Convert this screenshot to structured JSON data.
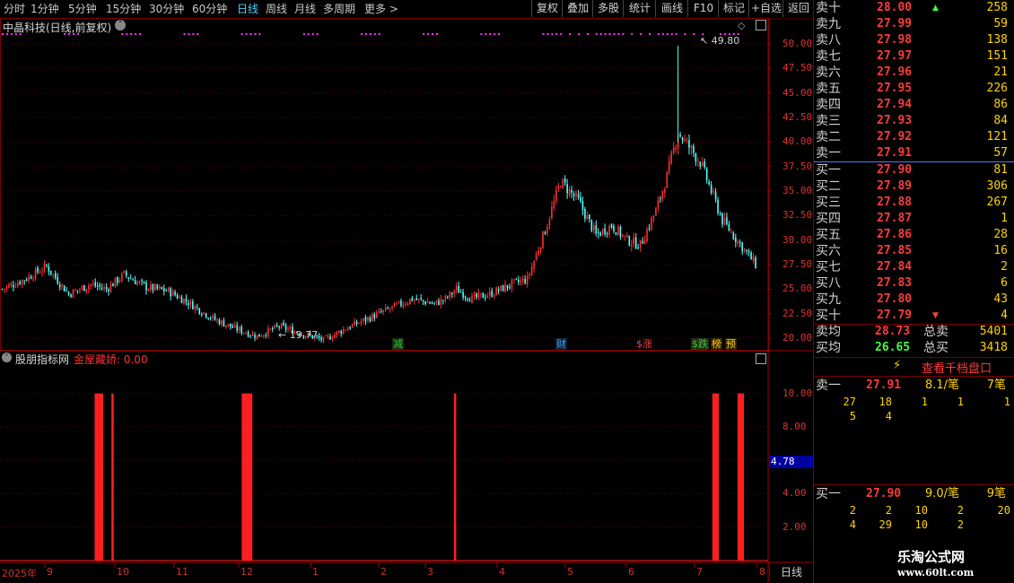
{
  "toolbar": {
    "periods": [
      "分时",
      "1分钟",
      "5分钟",
      "15分钟",
      "30分钟",
      "60分钟",
      "日线",
      "周线",
      "月线",
      "多周期",
      "更多 >"
    ],
    "active_period": "日线",
    "buttons": [
      "复权",
      "叠加",
      "多股",
      "统计",
      "画线",
      "F10",
      "标记",
      "+自选",
      "返回"
    ]
  },
  "chart": {
    "stock_title": "中晶科技(日线,前复权)",
    "price_axis": [
      "50.00",
      "47.50",
      "45.00",
      "42.50",
      "40.00",
      "37.50",
      "35.00",
      "32.50",
      "30.00",
      "27.50",
      "25.00",
      "22.50",
      "20.00"
    ],
    "high_label": "49.80",
    "low_label": "19.77",
    "events": [
      {
        "text": "减",
        "color": "#40c040"
      },
      {
        "text": "财",
        "color": "#40a0ff"
      },
      {
        "text": "$涨",
        "color": "#ff4040"
      },
      {
        "text": "$跌",
        "color": "#40c040"
      },
      {
        "text": "榜",
        "color": "#ffd400"
      },
      {
        "text": "预",
        "color": "#ffd400"
      }
    ],
    "indicator_title": "股朋指标网",
    "indicator_value_label": "金屋藏娇: 0.00",
    "indicator_axis": [
      "10.00",
      "8.00",
      "6.00",
      "4.00",
      "2.00"
    ],
    "indicator_cursor": "4.78",
    "date_axis": [
      "2025年",
      "9",
      "10",
      "11",
      "12",
      "1",
      "2",
      "3",
      "4",
      "5",
      "6",
      "7",
      "8"
    ],
    "period_label": "日线"
  },
  "chart_data": {
    "type": "line",
    "title": "中晶科技(日线,前复权)",
    "xlabel": "",
    "ylabel": "",
    "ylim": [
      19.0,
      51.0
    ],
    "x": [
      0,
      10,
      20,
      30,
      40,
      47,
      55,
      65,
      75,
      85,
      95,
      105,
      115,
      125,
      135,
      145,
      155,
      165,
      175,
      185,
      195,
      200,
      205,
      212,
      220,
      230,
      237,
      245,
      252,
      260,
      268,
      275,
      282,
      288,
      295,
      300,
      305,
      315,
      325,
      340
    ],
    "series": [
      {
        "name": "",
        "values": [
          25.0,
          26.0,
          27.3,
          24.5,
          25.5,
          25.0,
          26.5,
          25.2,
          24.8,
          23.5,
          22.0,
          21.0,
          20.2,
          21.2,
          20.5,
          19.8,
          21.0,
          22.0,
          23.0,
          24.0,
          23.5,
          24.0,
          25.0,
          24.0,
          24.5,
          25.5,
          26.0,
          31.0,
          36.0,
          34.0,
          30.5,
          31.5,
          30.0,
          29.5,
          33.0,
          36.5,
          41.0,
          38.0,
          32.0,
          27.5
        ]
      }
    ],
    "indicator_series": {
      "name": "金屋藏娇",
      "ylim": [
        0,
        11
      ],
      "spikes_x_index": [
        22,
        23,
        24,
        25,
        30,
        92,
        93,
        94,
        95,
        96,
        193,
        316,
        317,
        318,
        328,
        329,
        330
      ],
      "spike_value": 10.0
    }
  },
  "orderbook": {
    "asks": [
      {
        "label": "卖十",
        "price": "28.00",
        "vol": "258",
        "arrow": "up"
      },
      {
        "label": "卖九",
        "price": "27.99",
        "vol": "59"
      },
      {
        "label": "卖八",
        "price": "27.98",
        "vol": "138"
      },
      {
        "label": "卖七",
        "price": "27.97",
        "vol": "151"
      },
      {
        "label": "卖六",
        "price": "27.96",
        "vol": "21"
      },
      {
        "label": "卖五",
        "price": "27.95",
        "vol": "226"
      },
      {
        "label": "卖四",
        "price": "27.94",
        "vol": "86"
      },
      {
        "label": "卖三",
        "price": "27.93",
        "vol": "84"
      },
      {
        "label": "卖二",
        "price": "27.92",
        "vol": "121"
      },
      {
        "label": "卖一",
        "price": "27.91",
        "vol": "57"
      }
    ],
    "bids": [
      {
        "label": "买一",
        "price": "27.90",
        "vol": "81"
      },
      {
        "label": "买二",
        "price": "27.89",
        "vol": "306"
      },
      {
        "label": "买三",
        "price": "27.88",
        "vol": "267"
      },
      {
        "label": "买四",
        "price": "27.87",
        "vol": "1"
      },
      {
        "label": "买五",
        "price": "27.86",
        "vol": "28"
      },
      {
        "label": "买六",
        "price": "27.85",
        "vol": "16"
      },
      {
        "label": "买七",
        "price": "27.84",
        "vol": "2"
      },
      {
        "label": "买八",
        "price": "27.83",
        "vol": "6"
      },
      {
        "label": "买九",
        "price": "27.80",
        "vol": "43"
      },
      {
        "label": "买十",
        "price": "27.79",
        "vol": "4",
        "arrow": "down"
      }
    ],
    "avg_sell_label": "卖均",
    "avg_sell_price": "28.73",
    "total_sell_label": "总卖",
    "total_sell": "5401",
    "avg_buy_label": "买均",
    "avg_buy_price": "26.65",
    "total_buy_label": "总买",
    "total_buy": "3418",
    "view_button": "查看千档盘口",
    "ask1_label": "卖一",
    "ask1_price": "27.91",
    "ask1_avg": "8.1/笔",
    "ask1_count": "7笔",
    "ask1_queue": [
      [
        "27",
        "18",
        "1",
        "1",
        "1"
      ],
      [
        "5",
        "4"
      ]
    ],
    "bid1_label": "买一",
    "bid1_price": "27.90",
    "bid1_avg": "9.0/笔",
    "bid1_count": "9笔",
    "bid1_queue": [
      [
        "2",
        "2",
        "10",
        "2",
        "20"
      ],
      [
        "4",
        "29",
        "10",
        "2"
      ]
    ]
  },
  "watermark": {
    "line1": "乐淘公式网",
    "line2": "www.60lt.com"
  },
  "colors": {
    "up": "#ff3030",
    "down": "#54ffff",
    "grid": "#5a0000",
    "accent": "#4fd0ff",
    "magenta": "#ff30ff"
  }
}
